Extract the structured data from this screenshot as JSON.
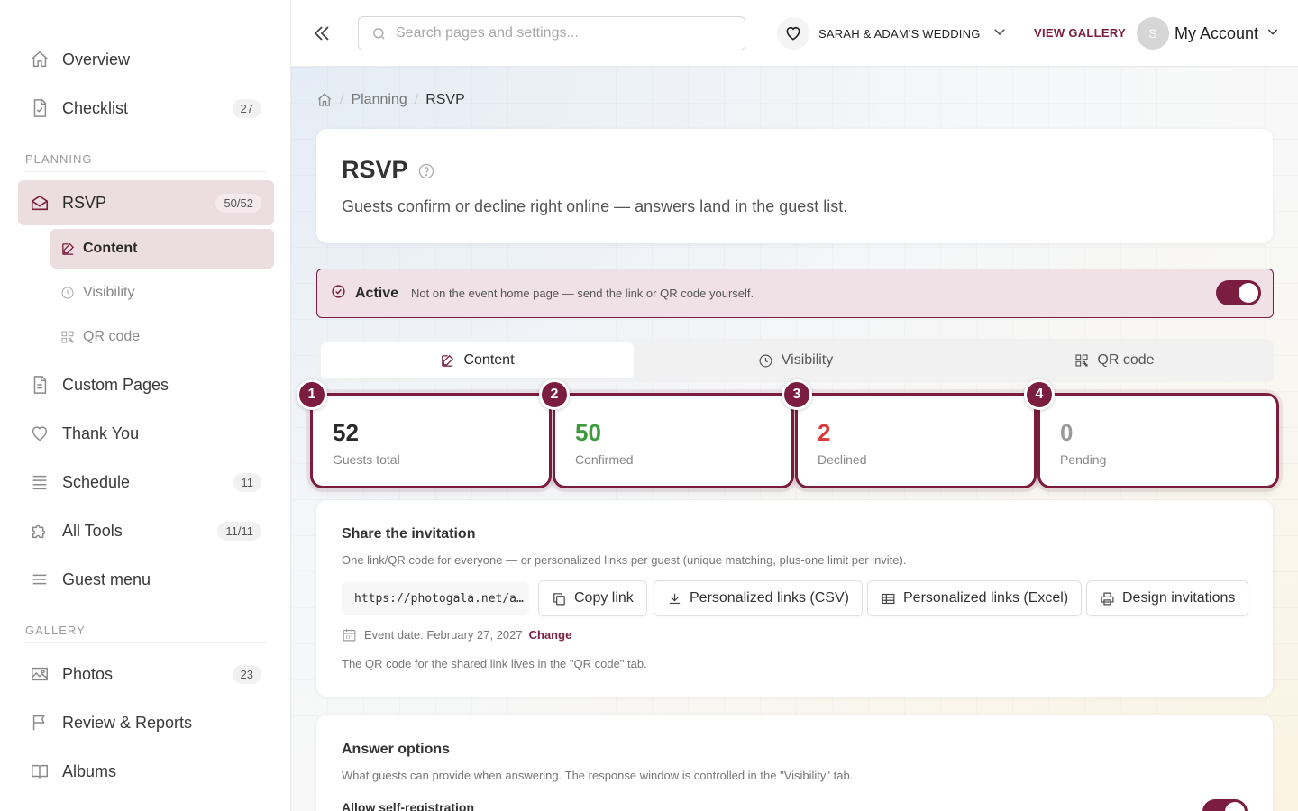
{
  "sidebar": {
    "items_top": [
      {
        "label": "Overview",
        "icon": "home-icon"
      },
      {
        "label": "Checklist",
        "icon": "checklist-icon",
        "count": "27"
      }
    ],
    "planning_header": "PLANNING",
    "rsvp": {
      "label": "RSVP",
      "count": "50/52",
      "icon": "envelope-open-icon"
    },
    "rsvp_sub": [
      {
        "label": "Content",
        "icon": "edit-icon"
      },
      {
        "label": "Visibility",
        "icon": "clock-icon"
      },
      {
        "label": "QR code",
        "icon": "qr-icon"
      }
    ],
    "planning_items": [
      {
        "label": "Custom Pages",
        "icon": "document-icon"
      },
      {
        "label": "Thank You",
        "icon": "heart-icon"
      },
      {
        "label": "Schedule",
        "icon": "list-icon",
        "count": "11"
      },
      {
        "label": "All Tools",
        "icon": "puzzle-icon",
        "count": "11/11"
      },
      {
        "label": "Guest menu",
        "icon": "menu-icon"
      }
    ],
    "gallery_header": "GALLERY",
    "gallery_items": [
      {
        "label": "Photos",
        "icon": "image-icon",
        "count": "23"
      },
      {
        "label": "Review & Reports",
        "icon": "flag-icon"
      },
      {
        "label": "Albums",
        "icon": "book-icon"
      }
    ]
  },
  "topbar": {
    "search_placeholder": "Search pages and settings...",
    "event_name": "SARAH & ADAM'S WEDDING",
    "view_gallery": "VIEW GALLERY",
    "avatar_initial": "S",
    "account_label": "My Account"
  },
  "breadcrumb": {
    "parent": "Planning",
    "current": "RSVP"
  },
  "header": {
    "title": "RSVP",
    "description": "Guests confirm or decline right online — answers land in the guest list."
  },
  "active_bar": {
    "label": "Active",
    "description": "Not on the event home page — send the link or QR code yourself.",
    "enabled": true
  },
  "tabs": [
    {
      "label": "Content",
      "icon": "edit-icon",
      "active": true
    },
    {
      "label": "Visibility",
      "icon": "clock-icon",
      "active": false
    },
    {
      "label": "QR code",
      "icon": "qr-icon",
      "active": false
    }
  ],
  "stats": [
    {
      "badge": "1",
      "value": "52",
      "label": "Guests total",
      "color": "#2a2a2a"
    },
    {
      "badge": "2",
      "value": "50",
      "label": "Confirmed",
      "color": "#3d9a3d"
    },
    {
      "badge": "3",
      "value": "2",
      "label": "Declined",
      "color": "#d93a3a"
    },
    {
      "badge": "4",
      "value": "0",
      "label": "Pending",
      "color": "#9a9a9a"
    }
  ],
  "share": {
    "title": "Share the invitation",
    "description": "One link/QR code for everyone — or personalized links per guest (unique matching, plus-one limit per invite).",
    "link": "https://photogala.net/a…",
    "buttons": {
      "copy": "Copy link",
      "csv": "Personalized links (CSV)",
      "excel": "Personalized links (Excel)",
      "design": "Design invitations"
    },
    "event_date": "Event date: February 27, 2027",
    "change": "Change",
    "qr_note": "The QR code for the shared link lives in the \"QR code\" tab."
  },
  "answers": {
    "title": "Answer options",
    "description": "What guests can provide when answering. The response window is controlled in the \"Visibility\" tab.",
    "self_registration": "Allow self-registration"
  },
  "colors": {
    "accent": "#7a1d3e",
    "accent_light": "#ecdde1"
  }
}
